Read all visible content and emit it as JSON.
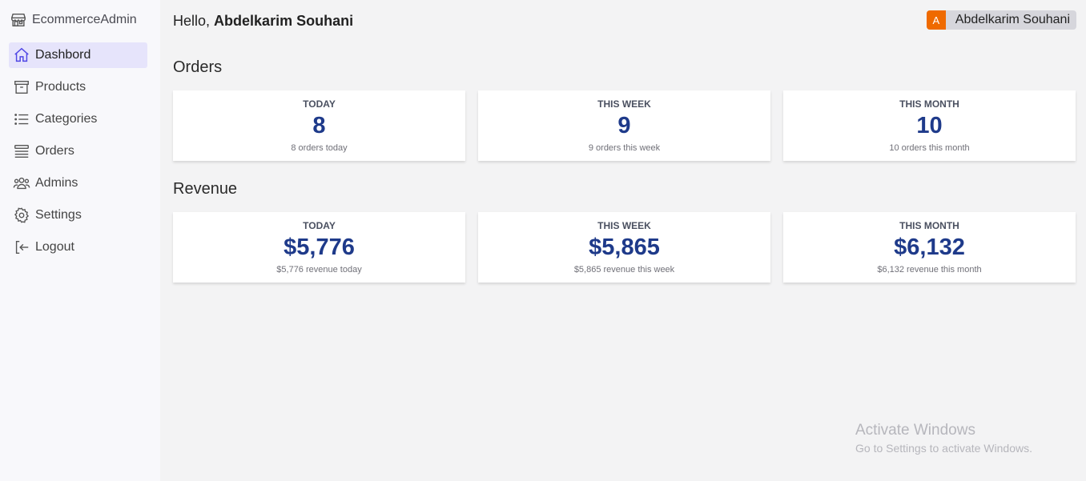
{
  "app": {
    "title": "EcommerceAdmin"
  },
  "sidebar": {
    "items": [
      {
        "label": "Dashbord",
        "icon": "home-icon",
        "active": true
      },
      {
        "label": "Products",
        "icon": "archive-box-icon"
      },
      {
        "label": "Categories",
        "icon": "list-icon"
      },
      {
        "label": "Orders",
        "icon": "queue-list-icon"
      },
      {
        "label": "Admins",
        "icon": "users-icon"
      },
      {
        "label": "Settings",
        "icon": "gear-icon"
      },
      {
        "label": "Logout",
        "icon": "logout-icon"
      }
    ]
  },
  "header": {
    "greeting_prefix": "Hello,",
    "user_name": "Abdelkarim Souhani",
    "avatar_initial": "A",
    "avatar_color": "#ef6a00"
  },
  "orders": {
    "title": "Orders",
    "cards": [
      {
        "label": "TODAY",
        "value": "8",
        "sub": "8 orders today"
      },
      {
        "label": "THIS WEEK",
        "value": "9",
        "sub": "9 orders this week"
      },
      {
        "label": "THIS MONTH",
        "value": "10",
        "sub": "10 orders this month"
      }
    ]
  },
  "revenue": {
    "title": "Revenue",
    "cards": [
      {
        "label": "TODAY",
        "value": "$5,776",
        "sub": "$5,776 revenue today"
      },
      {
        "label": "THIS WEEK",
        "value": "$5,865",
        "sub": "$5,865 revenue this week"
      },
      {
        "label": "THIS MONTH",
        "value": "$6,132",
        "sub": "$6,132 revenue this month"
      }
    ]
  },
  "watermark": {
    "line1": "Activate Windows",
    "line2": "Go to Settings to activate Windows."
  },
  "colors": {
    "accent": "#1e3a8a",
    "active_nav_bg": "#e6e4fb"
  }
}
